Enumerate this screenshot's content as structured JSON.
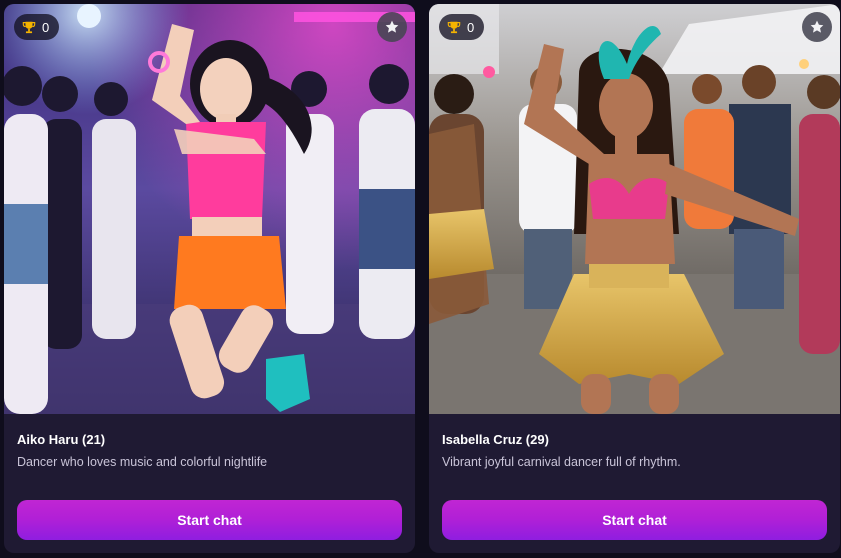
{
  "cards": [
    {
      "score": "0",
      "name": "Aiko Haru (21)",
      "description": "Dancer who loves music and colorful nightlife",
      "cta_label": "Start chat",
      "image_icon": "dancer-nightclub-photo"
    },
    {
      "score": "0",
      "name": "Isabella Cruz (29)",
      "description": "Vibrant joyful carnival dancer full of rhythm.",
      "cta_label": "Start chat",
      "image_icon": "carnival-dancer-photo"
    }
  ],
  "icons": {
    "badge": "trophy-icon",
    "favorite": "star-icon"
  },
  "colors": {
    "card_bg": "#1f1a33",
    "page_bg": "#0f0d1c",
    "cta_gradient_top": "#c026d3",
    "cta_gradient_bottom": "#8f1ee0",
    "trophy": "#f5b400"
  }
}
